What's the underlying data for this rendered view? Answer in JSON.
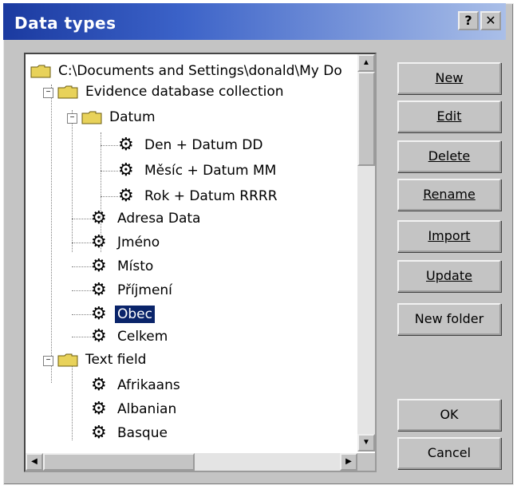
{
  "window": {
    "title": "Data types"
  },
  "titlebar_buttons": {
    "help": "?",
    "close": "✕"
  },
  "tree": {
    "root_path": "C:\\Documents and Settings\\donald\\My Do",
    "nodes": [
      {
        "label": "Evidence database collection",
        "kind": "folder"
      },
      {
        "label": "Datum",
        "kind": "folder"
      },
      {
        "label": "Den + Datum DD",
        "kind": "item"
      },
      {
        "label": "Měsíc + Datum MM",
        "kind": "item"
      },
      {
        "label": "Rok + Datum RRRR",
        "kind": "item"
      },
      {
        "label": "Adresa Data",
        "kind": "item"
      },
      {
        "label": "Jméno",
        "kind": "item"
      },
      {
        "label": "Místo",
        "kind": "item"
      },
      {
        "label": "Příjmení",
        "kind": "item"
      },
      {
        "label": "Obec",
        "kind": "item",
        "selected": true
      },
      {
        "label": "Celkem",
        "kind": "item"
      },
      {
        "label": "Text field",
        "kind": "folder"
      },
      {
        "label": "Afrikaans",
        "kind": "item"
      },
      {
        "label": "Albanian",
        "kind": "item"
      },
      {
        "label": "Basque",
        "kind": "item"
      }
    ]
  },
  "buttons": {
    "new": "New",
    "edit": "Edit",
    "delete": "Delete",
    "rename": "Rename",
    "import": "Import",
    "update": "Update",
    "new_folder": "New folder",
    "ok": "OK",
    "cancel": "Cancel"
  },
  "colors": {
    "selection": "#0a246a",
    "titlebar_start": "#1b3aa0",
    "folder": "#e8d25a"
  }
}
